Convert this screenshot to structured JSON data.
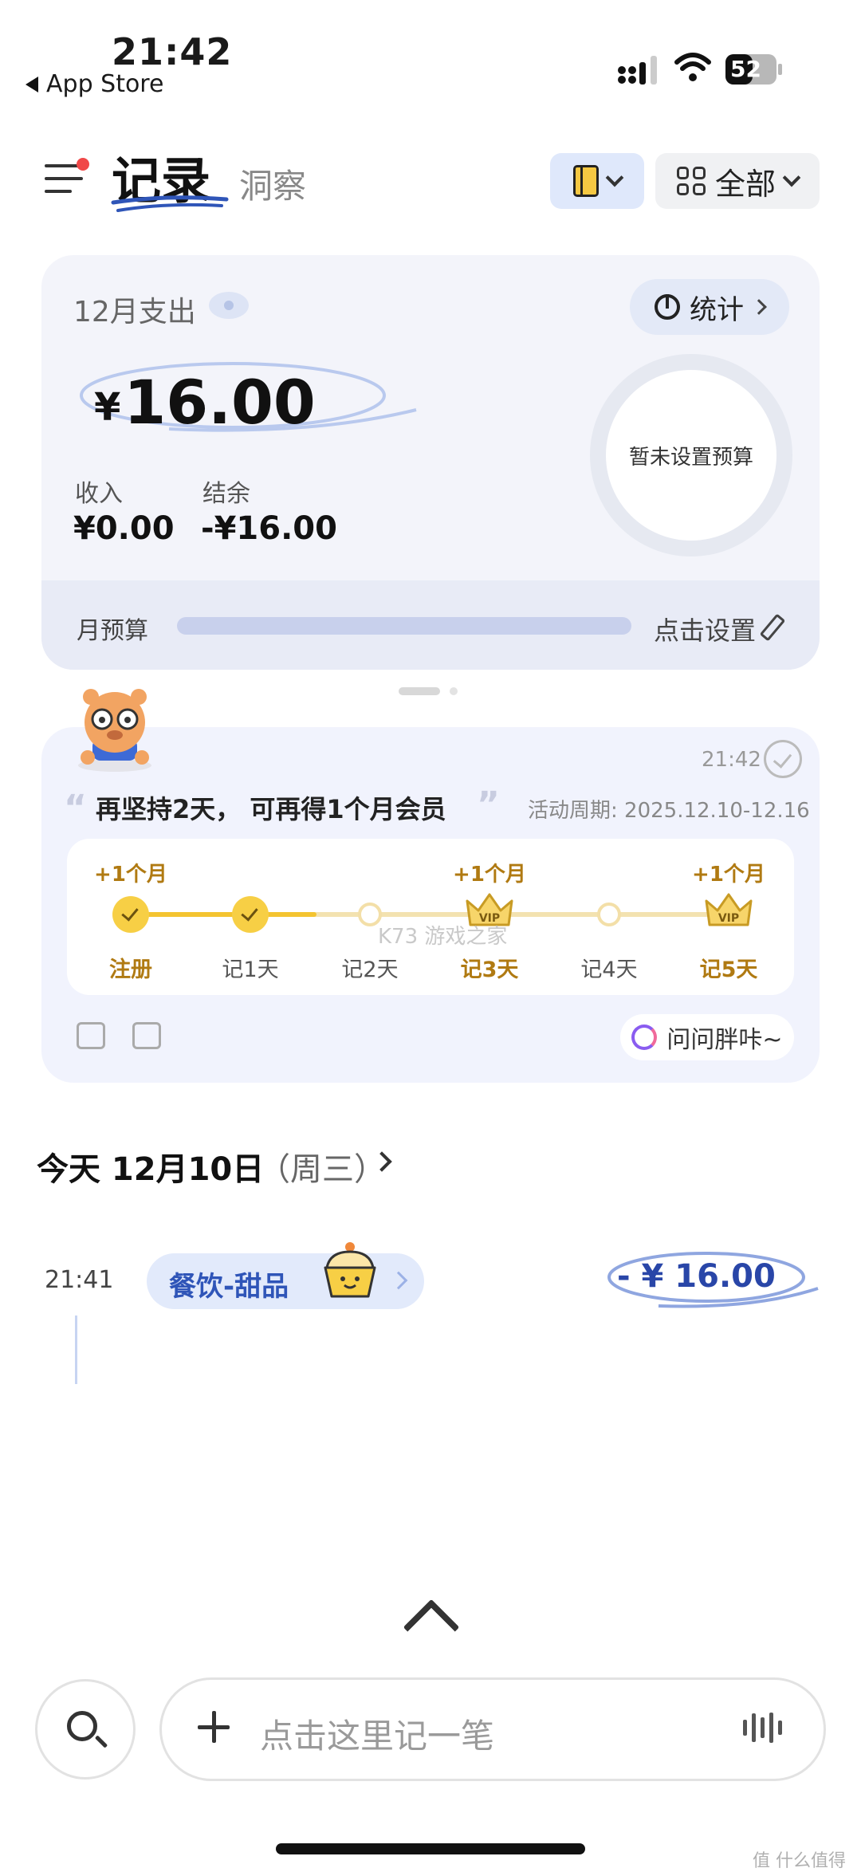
{
  "status_bar": {
    "time": "21:42",
    "back_app": "App Store",
    "battery": "52"
  },
  "header": {
    "tab_active": "记录",
    "tab_inactive": "洞察",
    "filter_label": "全部"
  },
  "summary": {
    "month_label": "12月支出",
    "stats_label": "统计",
    "expense_currency": "¥",
    "expense_amount": "16.00",
    "income_label": "收入",
    "income_value": "¥0.00",
    "balance_label": "结余",
    "balance_value": "-¥16.00",
    "budget_ring_text": "暂未设置预算",
    "monthly_budget_label": "月预算",
    "budget_set_label": "点击设置"
  },
  "challenge": {
    "time": "21:42",
    "quote": "再坚持2天， 可再得1个月会员",
    "period": "活动周期: 2025.12.10-12.16",
    "steps": [
      {
        "label": "注册",
        "reward": "+1个月",
        "state": "done"
      },
      {
        "label": "记1天",
        "reward": "",
        "state": "done"
      },
      {
        "label": "记2天",
        "reward": "",
        "state": "pending"
      },
      {
        "label": "记3天",
        "reward": "+1个月",
        "state": "vip"
      },
      {
        "label": "记4天",
        "reward": "",
        "state": "pending"
      },
      {
        "label": "记5天",
        "reward": "+1个月",
        "state": "vip"
      }
    ],
    "progress_fraction": 0.31,
    "watermark": "K73 游戏之家",
    "ask_label": "问问胖咔~"
  },
  "records": {
    "date_heading": "今天 12月10日",
    "weekday": "（周三）",
    "items": [
      {
        "time": "21:41",
        "category": "餐饮-甜品",
        "amount": "- ¥ 16.00"
      }
    ]
  },
  "bottom": {
    "input_placeholder": "点击这里记一笔",
    "corner_mark": "值 什么值得买"
  },
  "colors": {
    "accent_blue": "#2f55b8",
    "gold": "#f4c430",
    "card_bg": "#f3f4fa"
  },
  "icons": [
    "menu-icon",
    "notebook-icon",
    "grid-icon",
    "eye-icon",
    "pie-chart-icon",
    "pencil-icon",
    "check-icon",
    "crown-vip-icon",
    "thumb-up-icon",
    "thumb-down-icon",
    "ai-ask-icon",
    "cupcake-icon",
    "search-icon",
    "plus-icon",
    "voice-icon"
  ]
}
